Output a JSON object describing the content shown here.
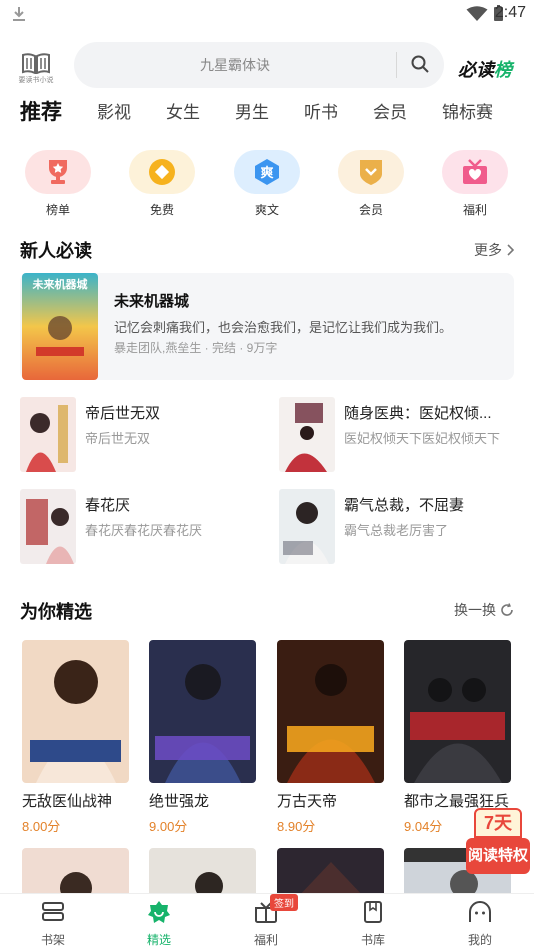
{
  "status_bar": {
    "time": "2:47"
  },
  "header": {
    "logo_text": "要读书小说",
    "search_placeholder": "九星霸体诀",
    "bidu_prefix": "必读",
    "bidu_suffix": "榜"
  },
  "tabs": [
    "推荐",
    "影视",
    "女生",
    "男生",
    "听书",
    "会员",
    "锦标赛"
  ],
  "quick": [
    {
      "label": "榜单",
      "icon": "trophy-icon",
      "bg": "#fde3e3",
      "color": "#f06a5f"
    },
    {
      "label": "免费",
      "icon": "coin-icon",
      "bg": "#fdf2d9",
      "color": "#f6b21e"
    },
    {
      "label": "爽文",
      "icon": "shuang-icon",
      "bg": "#ddeefe",
      "color": "#3b95f0",
      "glyph": "爽"
    },
    {
      "label": "会员",
      "icon": "vip-shield-icon",
      "bg": "#fcf0dd",
      "color": "#ebb04a"
    },
    {
      "label": "福利",
      "icon": "gift-heart-icon",
      "bg": "#fde2ea",
      "color": "#f05c8c"
    }
  ],
  "new_section": {
    "title": "新人必读",
    "more": "更多"
  },
  "featured": {
    "title": "未来机器城",
    "desc": "记忆会刺痛我们，也会治愈我们，是记忆让我们成为我们。",
    "meta": "暴走团队,燕垒生 · 完结 · 9万字",
    "cover_title": "未来机器城"
  },
  "small_books": [
    {
      "name": "帝后世无双",
      "sub": "帝后世无双"
    },
    {
      "name": "随身医典：医妃权倾...",
      "sub": "医妃权倾天下医妃权倾天下"
    },
    {
      "name": "春花厌",
      "sub": "春花厌春花厌春花厌"
    },
    {
      "name": "霸气总裁，不屈妻",
      "sub": "霸气总裁老厉害了"
    }
  ],
  "rec_section": {
    "title": "为你精选",
    "refresh": "换一换"
  },
  "recommended": [
    {
      "name": "无敌医仙战神",
      "score": "8.00分"
    },
    {
      "name": "绝世强龙",
      "score": "9.00分"
    },
    {
      "name": "万古天帝",
      "score": "8.90分"
    },
    {
      "name": "都市之最强狂兵",
      "score": "9.04分"
    }
  ],
  "promo": {
    "top": "7天",
    "bottom": "阅读特权"
  },
  "bottom_nav": [
    {
      "label": "书架",
      "icon": "bookshelf-icon"
    },
    {
      "label": "精选",
      "icon": "featured-icon",
      "active": true
    },
    {
      "label": "福利",
      "icon": "gift-icon",
      "badge": "签到"
    },
    {
      "label": "书库",
      "icon": "library-icon"
    },
    {
      "label": "我的",
      "icon": "profile-icon"
    }
  ],
  "colors": {
    "accent": "#17b36b",
    "score": "#e3822a",
    "promo": "#e8473b"
  }
}
